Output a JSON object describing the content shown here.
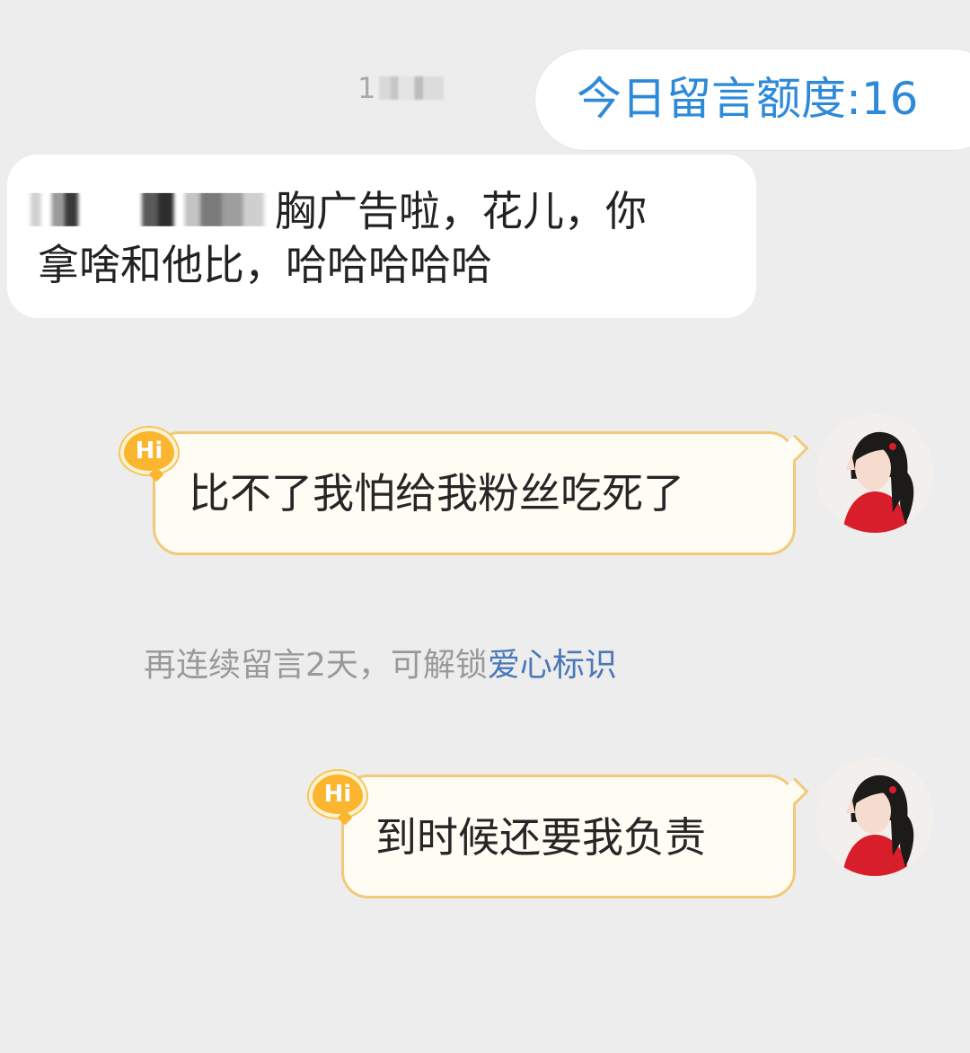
{
  "timestamp": {
    "visible_text": "1"
  },
  "quota": {
    "label": "今日留言额度:16"
  },
  "incoming_message": {
    "line1": "胸广告啦，花儿，你",
    "line2": "拿啥和他比，哈哈哈哈哈"
  },
  "outgoing_messages": [
    {
      "badge": "Hi",
      "text": "比不了我怕给我粉丝吃死了"
    },
    {
      "badge": "Hi",
      "text": "到时候还要我负责"
    }
  ],
  "hint": {
    "prefix": "再连续留言2天，可解锁",
    "link": "爱心标识"
  },
  "colors": {
    "background": "#ededed",
    "quota_text": "#2e8ad8",
    "bubble_border": "#f2c97a",
    "badge": "#fbb52e",
    "link": "#4a78b8"
  },
  "icons": {
    "badge_icon": "hi-badge-icon",
    "avatar": "user-avatar"
  }
}
